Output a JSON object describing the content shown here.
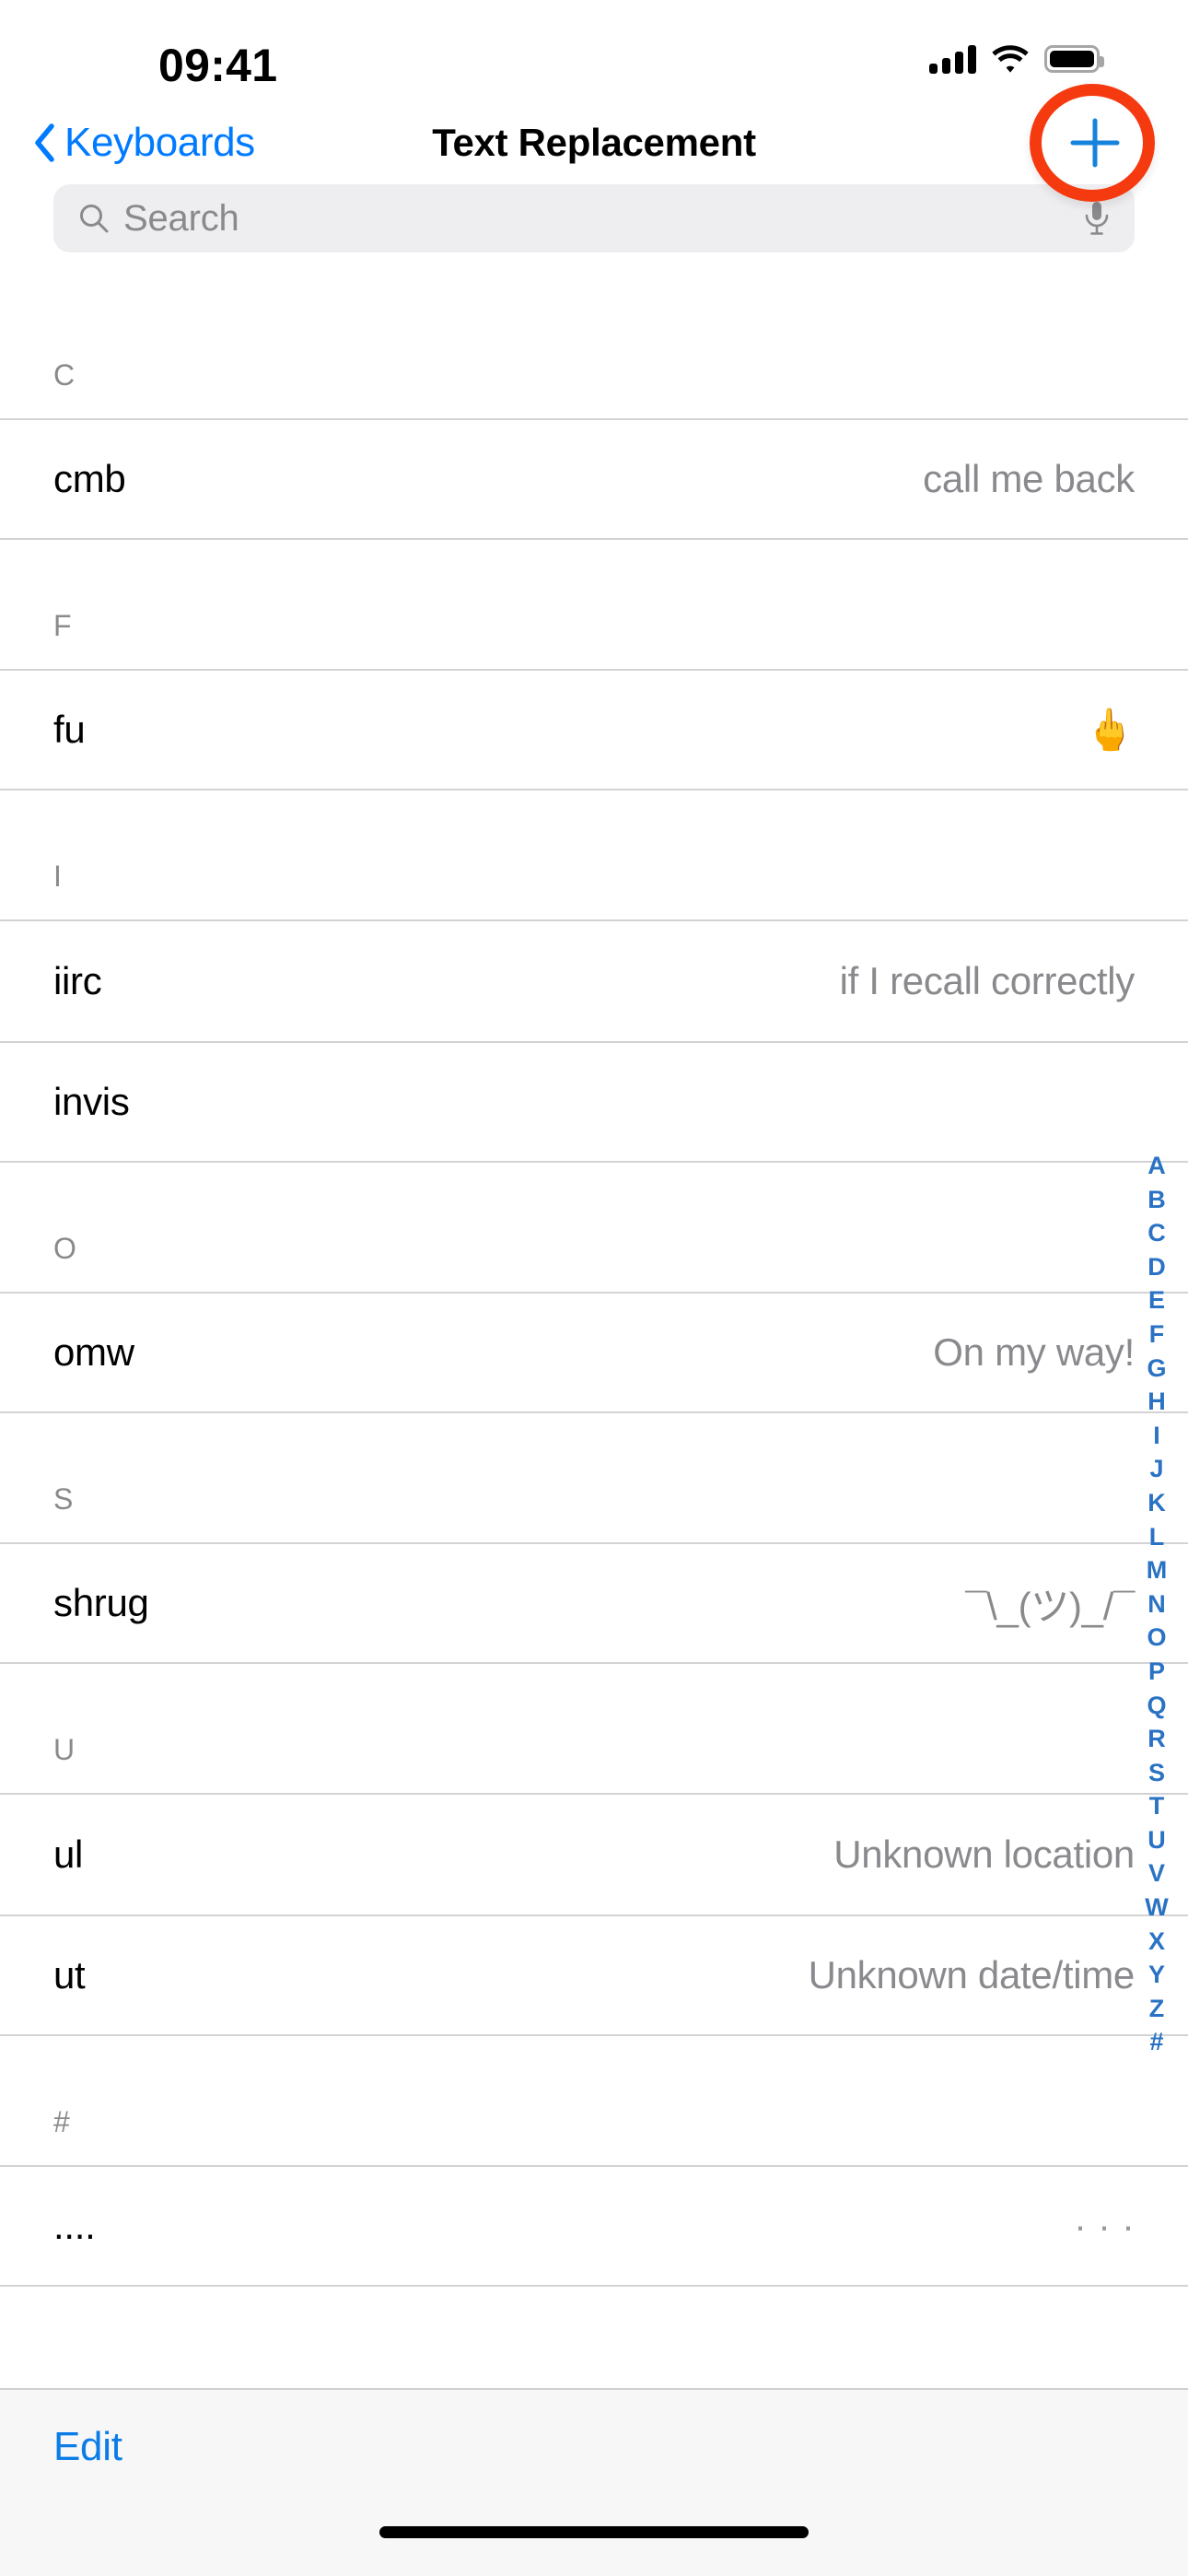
{
  "status_bar": {
    "time": "09:41",
    "icons": [
      "cellular-signal-icon",
      "wifi-icon",
      "battery-icon"
    ]
  },
  "nav_bar": {
    "back_label": "Keyboards",
    "back_icon": "chevron-left-icon",
    "title": "Text Replacement",
    "add_icon": "plus-icon",
    "annotation_color": "#F63A10",
    "accent_color": "#007AFF"
  },
  "search": {
    "placeholder": "Search",
    "search_icon": "magnifier-icon",
    "mic_icon": "microphone-icon"
  },
  "list": {
    "sections": [
      {
        "letter": "C",
        "rows": [
          {
            "shortcut": "cmb",
            "phrase": "call me back",
            "kind": "text"
          }
        ]
      },
      {
        "letter": "F",
        "rows": [
          {
            "shortcut": "fu",
            "phrase": "🖕",
            "kind": "emoji"
          }
        ]
      },
      {
        "letter": "I",
        "rows": [
          {
            "shortcut": "iirc",
            "phrase": "if I recall correctly",
            "kind": "text"
          },
          {
            "shortcut": "invis",
            "phrase": "",
            "kind": "text"
          }
        ]
      },
      {
        "letter": "O",
        "rows": [
          {
            "shortcut": "omw",
            "phrase": "On my way!",
            "kind": "text"
          }
        ]
      },
      {
        "letter": "S",
        "rows": [
          {
            "shortcut": "shrug",
            "phrase": "¯\\_(ツ)_/¯",
            "kind": "text"
          }
        ]
      },
      {
        "letter": "U",
        "rows": [
          {
            "shortcut": "ul",
            "phrase": "Unknown location",
            "kind": "text"
          },
          {
            "shortcut": "ut",
            "phrase": "Unknown date/time",
            "kind": "text"
          }
        ]
      },
      {
        "letter": "#",
        "rows": [
          {
            "shortcut": "....",
            "phrase": "···",
            "kind": "dots"
          }
        ]
      }
    ]
  },
  "index_bar": {
    "letters": [
      "A",
      "B",
      "C",
      "D",
      "E",
      "F",
      "G",
      "H",
      "I",
      "J",
      "K",
      "L",
      "M",
      "N",
      "O",
      "P",
      "Q",
      "R",
      "S",
      "T",
      "U",
      "V",
      "W",
      "X",
      "Y",
      "Z",
      "#"
    ],
    "color": "#2a72c4"
  },
  "toolbar": {
    "edit_label": "Edit"
  },
  "home_indicator": "home-indicator"
}
